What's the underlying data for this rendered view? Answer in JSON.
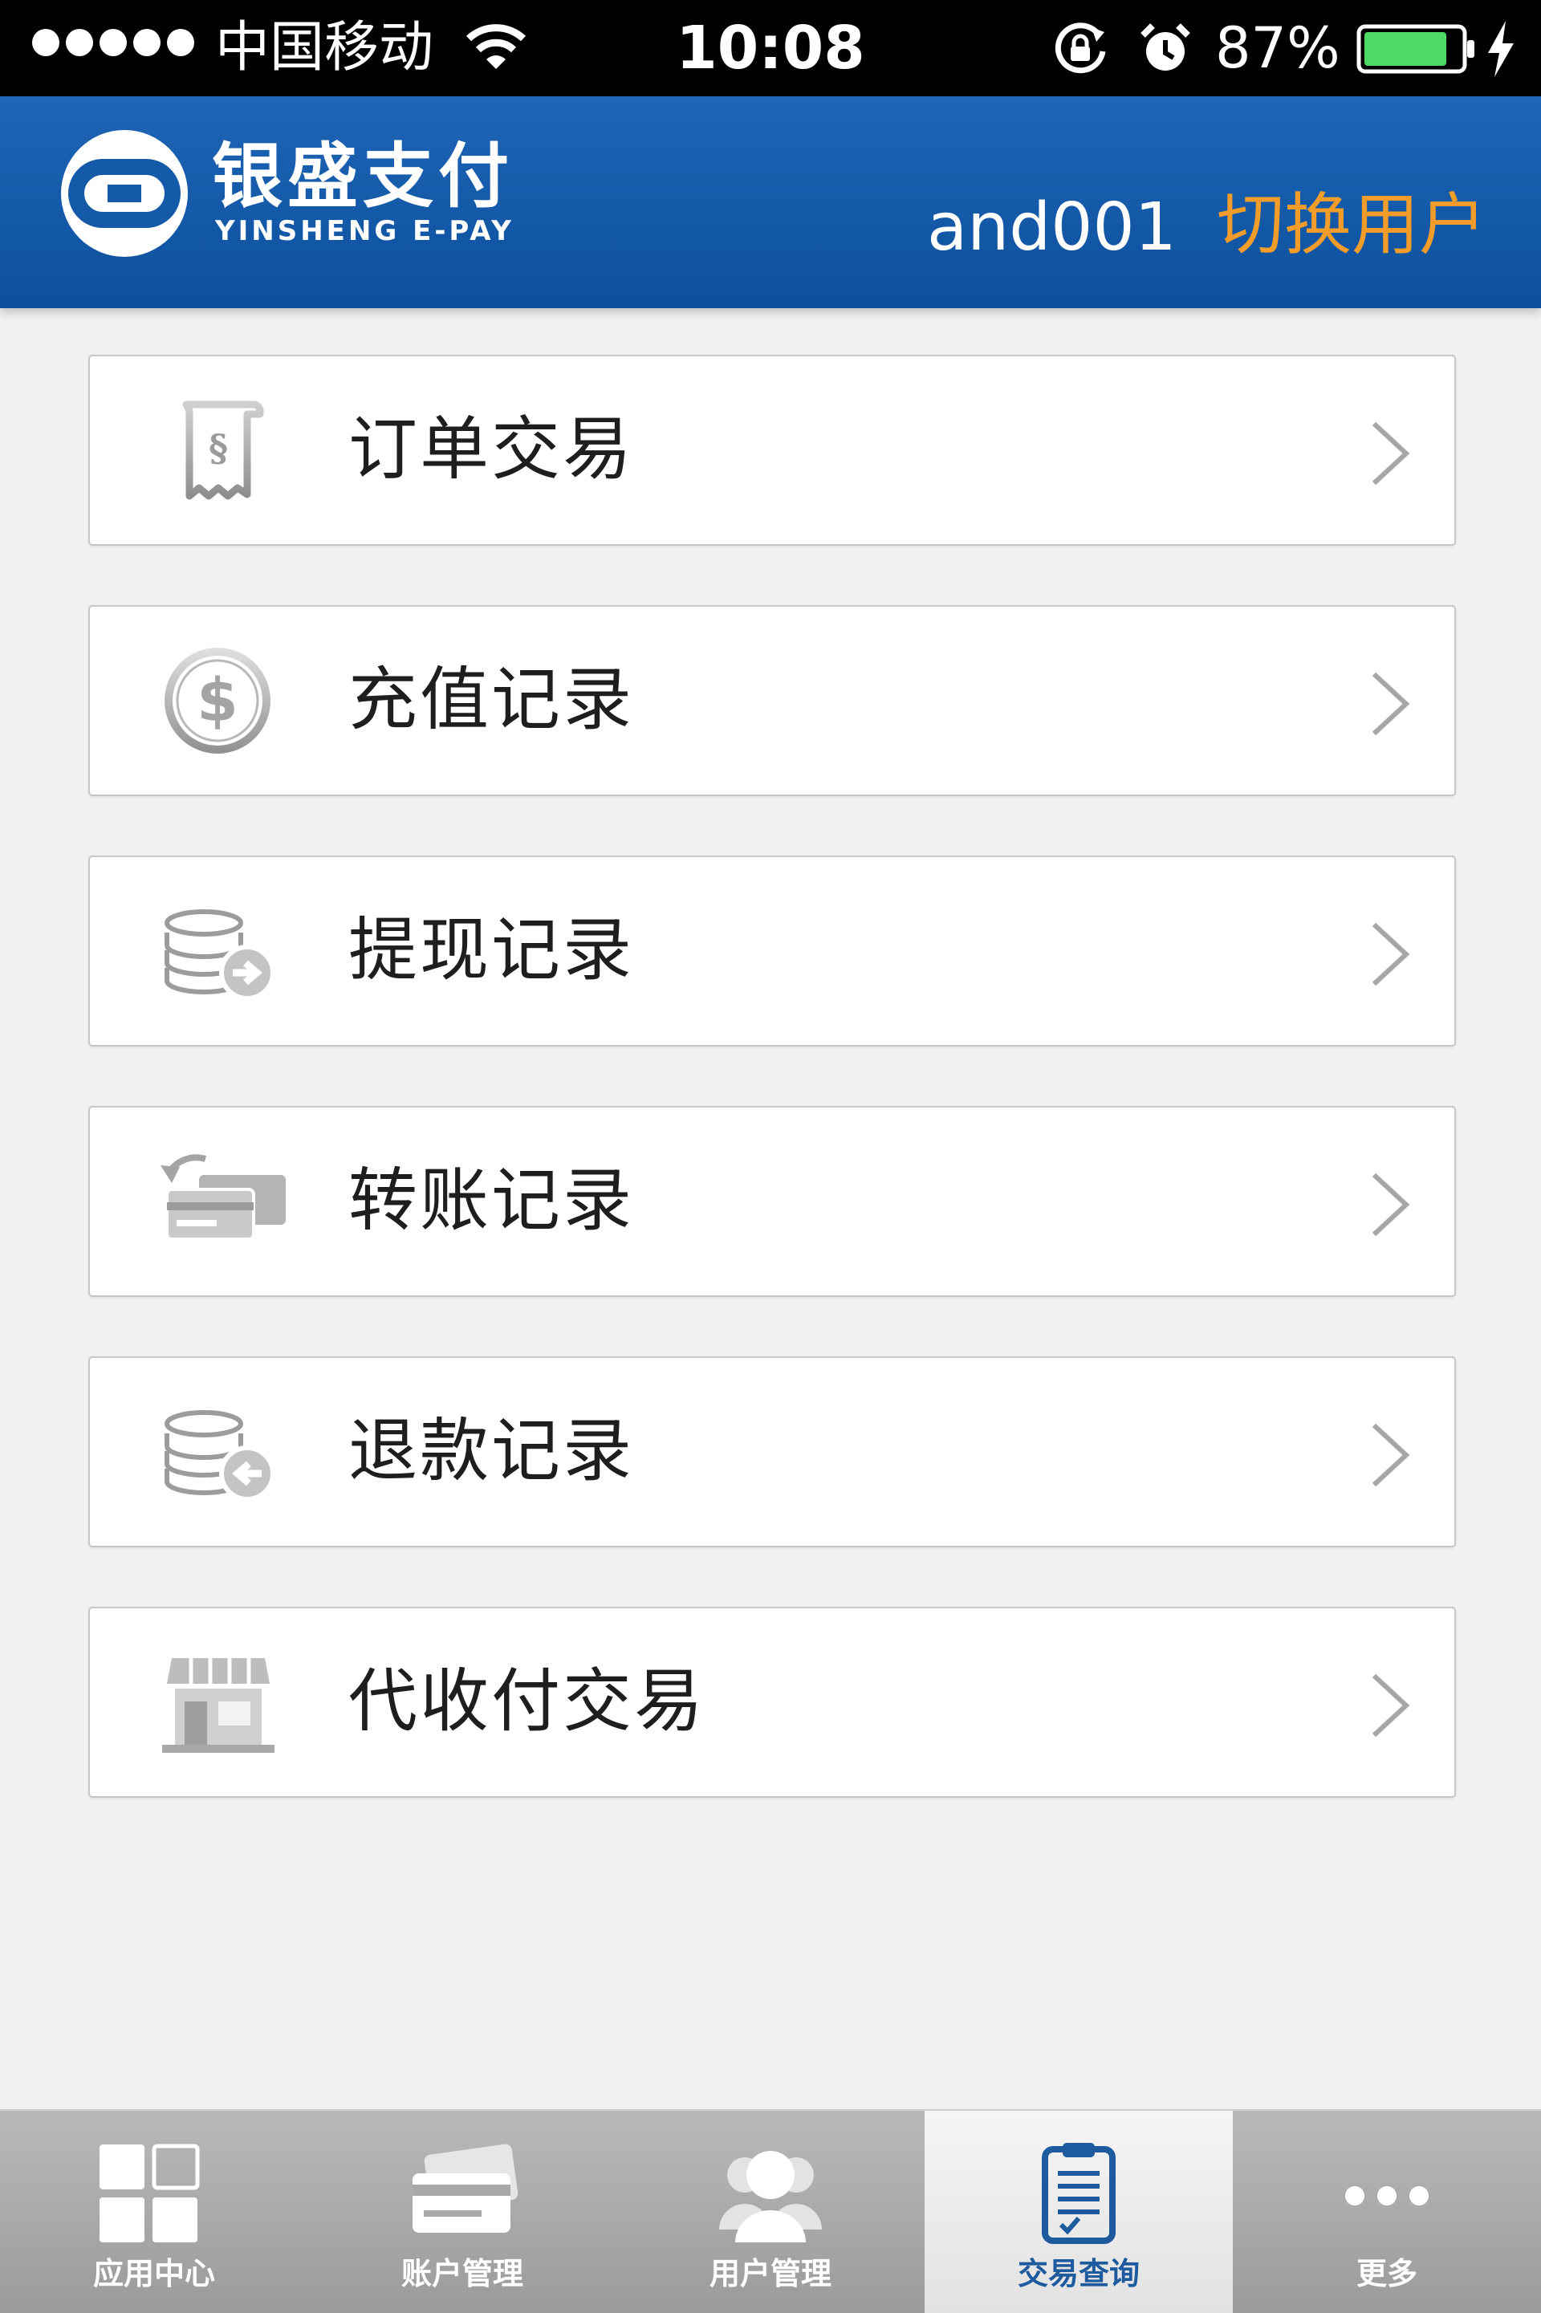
{
  "status_bar": {
    "carrier": "中国移动",
    "time": "10:08",
    "battery_percent": "87%",
    "battery_level": 0.87,
    "signal_bars": 5
  },
  "header": {
    "brand_cn": "银盛支付",
    "brand_en": "YINSHENG E-PAY",
    "username": "and001",
    "switch_user": "切换用户",
    "accent_color": "#f29d2a",
    "header_color": "#145aa9"
  },
  "menu": {
    "items": [
      {
        "label": "订单交易",
        "icon": "receipt-icon"
      },
      {
        "label": "充值记录",
        "icon": "dollar-coin-icon"
      },
      {
        "label": "提现记录",
        "icon": "coins-withdraw-icon"
      },
      {
        "label": "转账记录",
        "icon": "card-transfer-icon"
      },
      {
        "label": "退款记录",
        "icon": "coins-refund-icon"
      },
      {
        "label": "代收付交易",
        "icon": "store-icon"
      }
    ]
  },
  "tabbar": {
    "tabs": [
      {
        "label": "应用中心",
        "icon": "grid-icon",
        "active": false
      },
      {
        "label": "账户管理",
        "icon": "cards-icon",
        "active": false
      },
      {
        "label": "用户管理",
        "icon": "users-icon",
        "active": false
      },
      {
        "label": "交易查询",
        "icon": "clipboard-icon",
        "active": true
      },
      {
        "label": "更多",
        "icon": "more-dots-icon",
        "active": false
      }
    ]
  }
}
